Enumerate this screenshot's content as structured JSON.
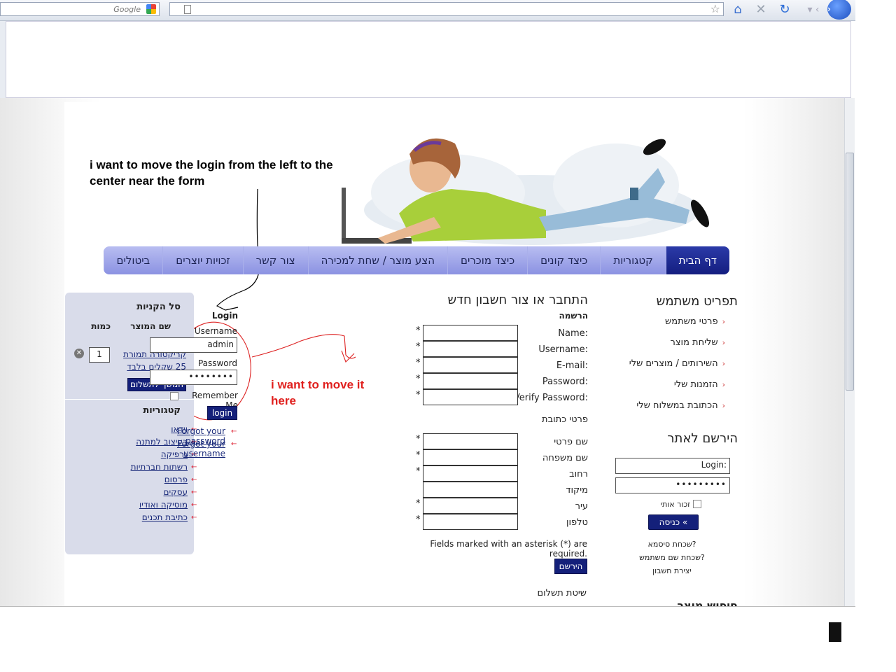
{
  "browser": {
    "search_placeholder": "Google",
    "url": ""
  },
  "annotations": {
    "top_note": "i want to move the login from the left to the center near the form",
    "red_note": "i want to move it here"
  },
  "nav": {
    "items": [
      "דף הבית",
      "קטגוריות",
      "כיצד קונים",
      "כיצד מוכרים",
      "הצע מוצר / שחת למכירה",
      "צור קשר",
      "זכויות יוצרים",
      "ביטולים"
    ]
  },
  "cart": {
    "title": "סל הקניות",
    "col_product": "שם המוצר",
    "col_qty": "כמות",
    "item_name_a": "קריקטורה תמורת",
    "item_name_b": "25 שקלים בלבד",
    "item_qty": "1",
    "checkout_button": "המשך לתשלום"
  },
  "categories": {
    "title": "קטגוריות",
    "items": [
      "וידאו",
      "בעיצוב למתנה",
      "גרפיקה",
      "רשתות חברתיות",
      "פרסום",
      "עסקים",
      "מוסיקה ואודיו",
      "כתיבת תכנים"
    ]
  },
  "login_overlay": {
    "title": "Login",
    "username_label": "Username",
    "username_value": "admin",
    "password_label": "Password",
    "password_value": "••••••••",
    "remember_label": "Remember Me",
    "login_button": "login",
    "forgot_password": "Forgot your password",
    "forgot_username": "Forgot your username"
  },
  "form": {
    "title": "התחבר או צור חשבון חדש",
    "section_register": "הרשמה",
    "name_label": ":Name",
    "username_label": ":Username",
    "email_label": ":E-mail",
    "password_label": ":Password",
    "verify_label": ":Verify Password",
    "section_address": "פרטי כתובת",
    "first_name": "שם פרטי",
    "last_name": "שם משפחה",
    "street": "רחוב",
    "zip": "מיקוד",
    "city": "עיר",
    "phone": "טלפון",
    "required_note": "Fields marked with an asterisk (*) are required.",
    "register_button": "הירשם",
    "payment_section": "שיטת תשלום",
    "asterisk": "*"
  },
  "user_menu": {
    "title": "תפריט משתמש",
    "items": [
      "פרטי משתמש",
      "שליחת מוצר",
      "השירותים / מוצרים שלי",
      "הזמנות שלי",
      "הכתובת במשלוח שלי"
    ]
  },
  "site_register": {
    "title": "הירשם לאתר",
    "login_value": "Login:",
    "password_value": "•••••••••",
    "remember_label": "זכור אותי",
    "enter_button": "כניסה",
    "forgot_password": "שכחת סיסמא?",
    "forgot_username": "שכחת שם משתמש?",
    "create_account": "יצירת חשבון",
    "cut_heading": "חיפוש מוצר"
  }
}
